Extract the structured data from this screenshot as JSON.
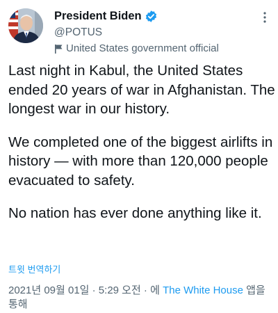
{
  "author": {
    "display_name": "President Biden",
    "handle": "@POTUS",
    "account_label": "United States government official"
  },
  "icons": {
    "verified": "verified-badge-icon",
    "label": "flag-icon",
    "more": "more-vertical-icon"
  },
  "colors": {
    "accent": "#1d9bf0",
    "text": "#0f1419",
    "secondary": "#536471"
  },
  "tweet": {
    "paragraphs": [
      "Last night in Kabul, the United States ended 20 years of war in Afghanistan. The longest war in our history.",
      "We completed one of the biggest airlifts in history — with more than 120,000 people evacuated to safety.",
      "No nation has ever done anything like it."
    ],
    "translate_label": "트윗 번역하기"
  },
  "meta": {
    "timestamp": "2021년 09월 01일 · 5:29 오전 · ",
    "via_prefix": "에 ",
    "source": "The White House",
    "source_suffix": " 앱을 통해"
  }
}
